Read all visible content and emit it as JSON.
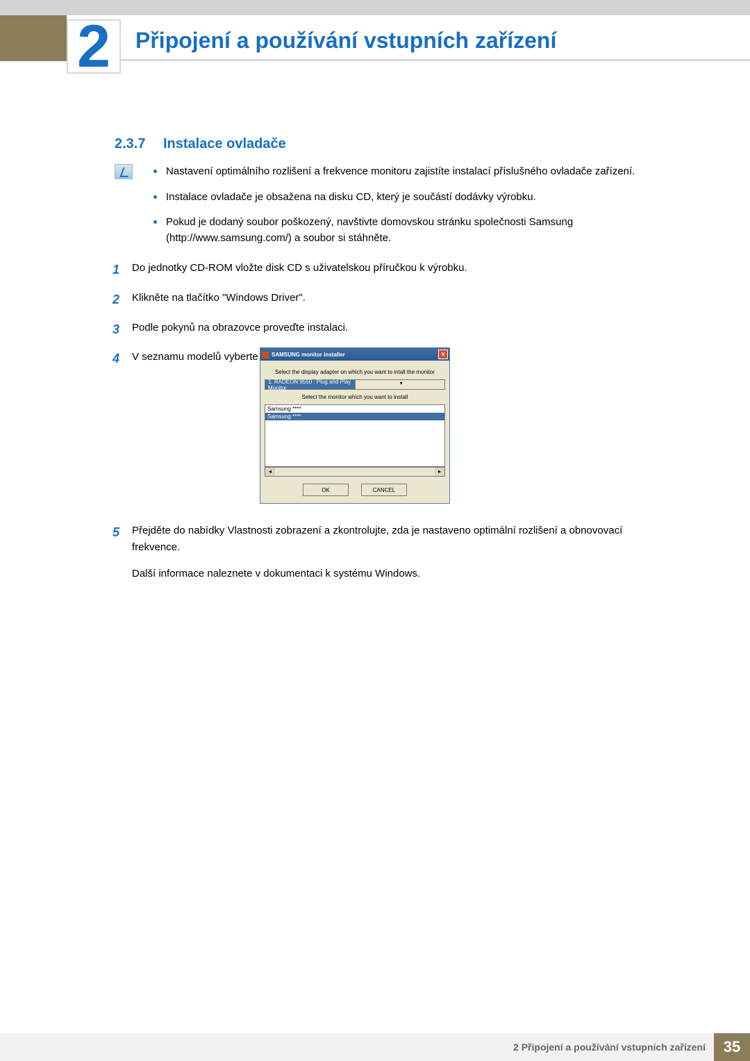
{
  "chapter": {
    "number": "2",
    "title": "Připojení a používání vstupních zařízení"
  },
  "section": {
    "number": "2.3.7",
    "title": "Instalace ovladače"
  },
  "notes": {
    "n1": "Nastavení optimálního rozlišení a frekvence monitoru zajistíte instalací příslušného ovladače zařízení.",
    "n2": "Instalace ovladače je obsažena na disku CD, který je součástí dodávky výrobku.",
    "n3": "Pokud je dodaný soubor poškozený, navštivte domovskou stránku společnosti Samsung (http://www.samsung.com/) a soubor si stáhněte."
  },
  "steps": {
    "s1": {
      "num": "1",
      "text": "Do jednotky CD-ROM vložte disk CD s uživatelskou příručkou k výrobku."
    },
    "s2": {
      "num": "2",
      "text": "Klikněte na tlačítko \"Windows Driver\"."
    },
    "s3": {
      "num": "3",
      "text": "Podle pokynů na obrazovce proveďte instalaci."
    },
    "s4": {
      "num": "4",
      "text": "V seznamu modelů vyberte svůj model výrobku."
    },
    "s5": {
      "num": "5",
      "text": "Přejděte do nabídky Vlastnosti zobrazení a zkontrolujte, zda je nastaveno optimální rozlišení a obnovovací frekvence.",
      "extra": "Další informace naleznete v dokumentaci k systému Windows."
    }
  },
  "installer": {
    "title": "SAMSUNG monitor installer",
    "close": "×",
    "label1": "Select the display adapter on which you want to intall the monitor",
    "dropdown": "1. RADEON 9550 : Plug and Play Monitor",
    "dd_btn": "▾",
    "label2": "Select the monitor which you want to install",
    "list_item1": "Samsung ****",
    "list_item2": "Samsung ****",
    "sb_left": "◂",
    "sb_right": "▸",
    "ok": "OK",
    "cancel": "CANCEL"
  },
  "footer": {
    "text": "2 Připojení a používání vstupních zařízení",
    "page": "35"
  }
}
